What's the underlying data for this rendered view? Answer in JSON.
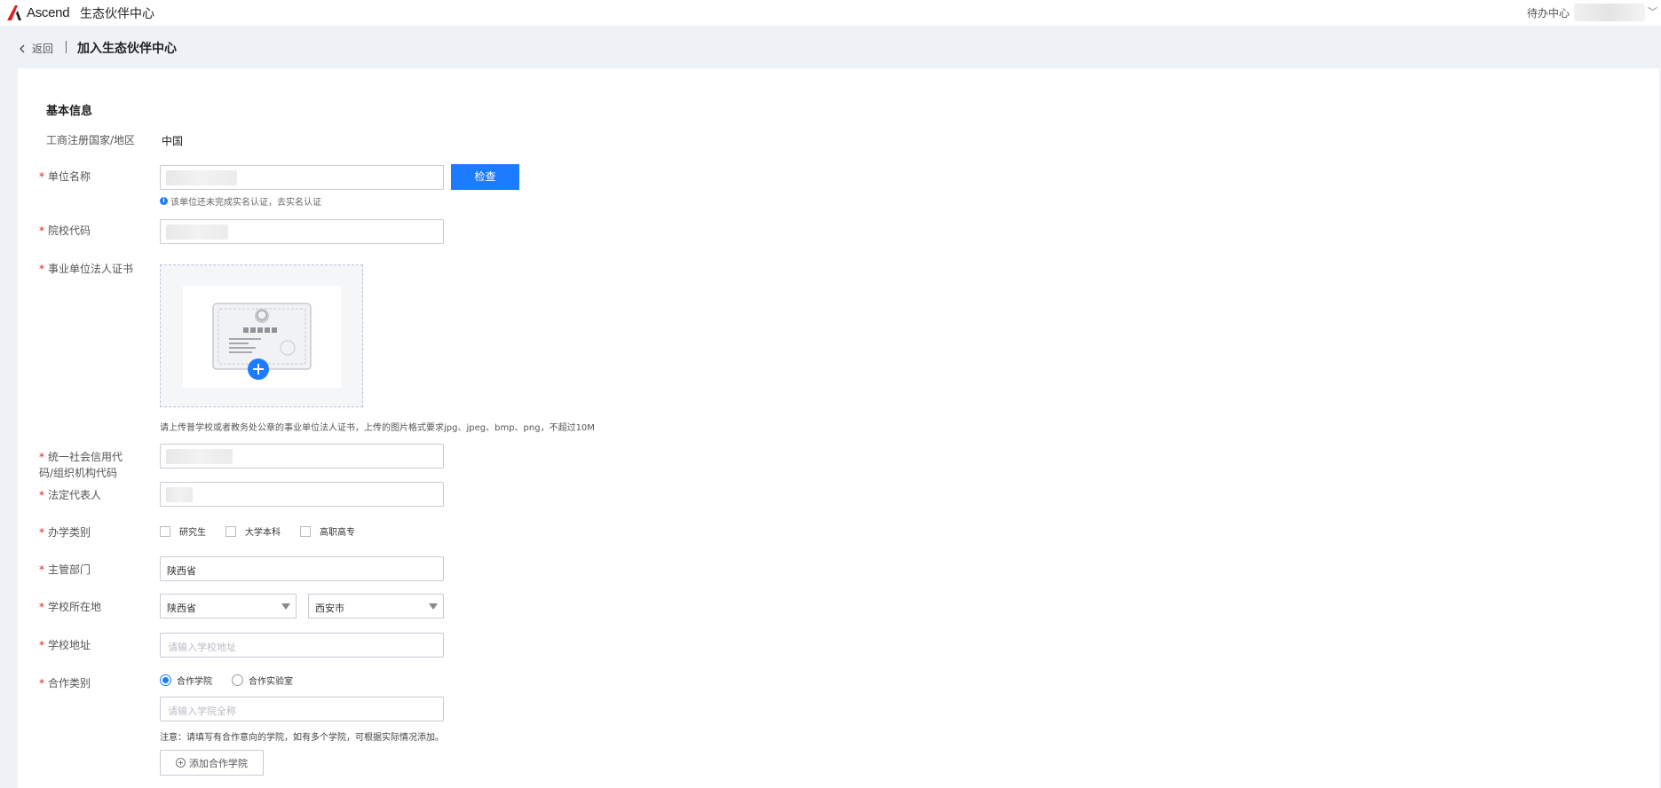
{
  "header": {
    "logo_text": "Ascend",
    "brand_title": "生态伙伴中心",
    "todo_label": "待办中心",
    "accent_color": "#1c7cff",
    "logo_color": "#e02020"
  },
  "breadcrumb": {
    "back_label": "返回",
    "page_title": "加入生态伙伴中心"
  },
  "form": {
    "section_title": "基本信息",
    "required_mark": "*",
    "registration_country": {
      "label": "工商注册国家/地区",
      "value": "中国"
    },
    "org_name": {
      "label": "单位名称",
      "check_button": "检查",
      "hint": "该单位还未完成实名认证，去实名认证"
    },
    "school_code": {
      "label": "院校代码"
    },
    "certificate": {
      "label": "事业单位法人证书",
      "note": "请上传普学校或者教务处公章的事业单位法人证书，上传的图片格式要求jpg、jpeg、bmp、png，不超过10M"
    },
    "credit_code": {
      "label": "统一社会信用代码/组织机构代码"
    },
    "legal_rep": {
      "label": "法定代表人"
    },
    "school_type": {
      "label": "办学类别",
      "options": [
        "研究生",
        "大学本科",
        "高职高专"
      ]
    },
    "authority": {
      "label": "主管部门",
      "value": "陕西省"
    },
    "location": {
      "label": "学校所在地",
      "province": "陕西省",
      "city": "西安市"
    },
    "address": {
      "label": "学校地址",
      "placeholder": "请输入学校地址"
    },
    "cooperation": {
      "label": "合作类别",
      "options": [
        "合作学院",
        "合作实验室"
      ],
      "selected": "合作学院",
      "college_placeholder": "请输入学院全称",
      "note": "注意：请填写有合作意向的学院，如有多个学院，可根据实际情况添加。",
      "add_button": "添加合作学院"
    }
  }
}
